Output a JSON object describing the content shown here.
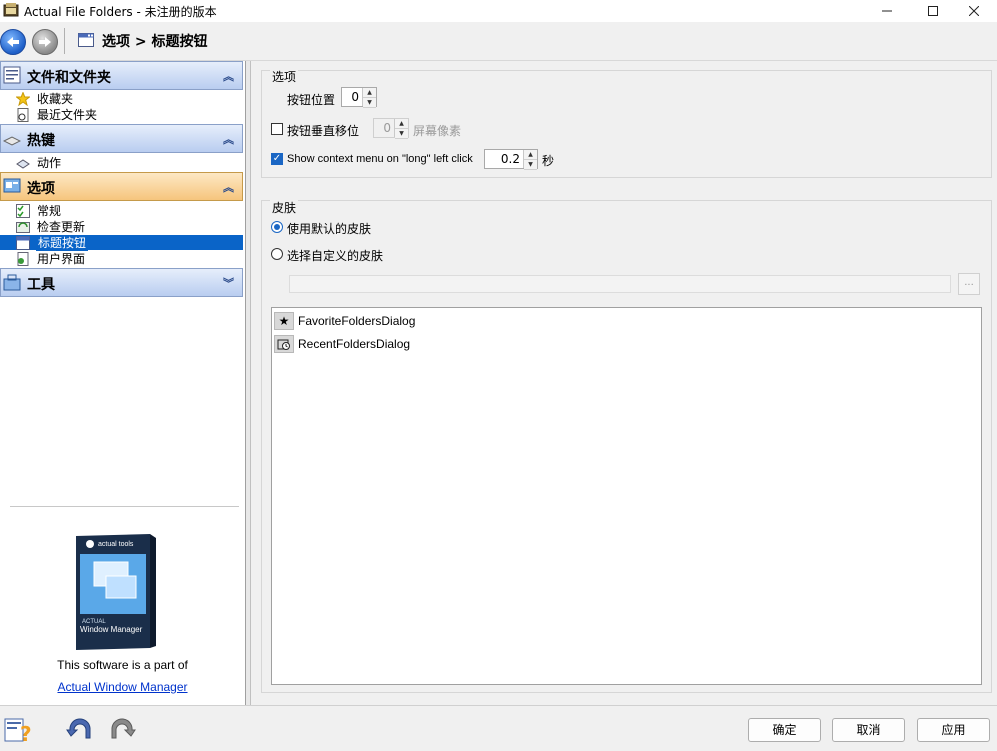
{
  "window": {
    "title": "Actual File Folders - 未注册的版本"
  },
  "toolbar": {
    "breadcrumb": "选项 > 标题按钮"
  },
  "sidebar": {
    "groups": [
      {
        "title": "文件和文件夹",
        "icon": "folder-list-icon",
        "expanded": true,
        "items": [
          {
            "label": "收藏夹",
            "icon": "star-icon"
          },
          {
            "label": "最近文件夹",
            "icon": "recent-doc-icon"
          }
        ]
      },
      {
        "title": "热键",
        "icon": "keyboard-icon",
        "expanded": true,
        "items": [
          {
            "label": "动作",
            "icon": "action-icon"
          }
        ]
      },
      {
        "title": "选项",
        "icon": "options-icon",
        "expanded": true,
        "active": true,
        "items": [
          {
            "label": "常规",
            "icon": "checklist-icon"
          },
          {
            "label": "检查更新",
            "icon": "update-icon"
          },
          {
            "label": "标题按钮",
            "icon": "title-button-icon",
            "selected": true
          },
          {
            "label": "用户界面",
            "icon": "ui-icon"
          }
        ]
      },
      {
        "title": "工具",
        "icon": "tools-icon",
        "expanded": false,
        "items": []
      }
    ],
    "promo": {
      "box_brand": "actual tools",
      "box_product_top": "ACTUAL",
      "box_product": "Window Manager",
      "text": "This software is a part of",
      "link": "Actual Window Manager"
    }
  },
  "options_group": {
    "label": "选项",
    "button_position_label": "按钮位置",
    "button_position_value": "0",
    "vertical_offset_label": "按钮垂直移位",
    "vertical_offset_checked": false,
    "vertical_offset_value": "0",
    "vertical_offset_unit": "屏幕像素",
    "context_menu_label": "Show context menu on \"long\" left click",
    "context_menu_checked": true,
    "context_menu_value": "0.2",
    "context_menu_unit": "秒"
  },
  "skin_group": {
    "label": "皮肤",
    "default_skin_label": "使用默认的皮肤",
    "default_skin_selected": true,
    "custom_skin_label": "选择自定义的皮肤",
    "custom_skin_selected": false,
    "path_value": "",
    "browse_label": "...",
    "list_items": [
      {
        "label": "FavoriteFoldersDialog",
        "icon": "star-icon"
      },
      {
        "label": "RecentFoldersDialog",
        "icon": "recent-folders-icon"
      }
    ]
  },
  "buttons": {
    "ok": "确定",
    "cancel": "取消",
    "apply": "应用"
  },
  "colors": {
    "selection": "#0a64c8",
    "group_header": "#b9cdf0",
    "active_group_header": "#f6c57d",
    "link": "#0033cc"
  }
}
